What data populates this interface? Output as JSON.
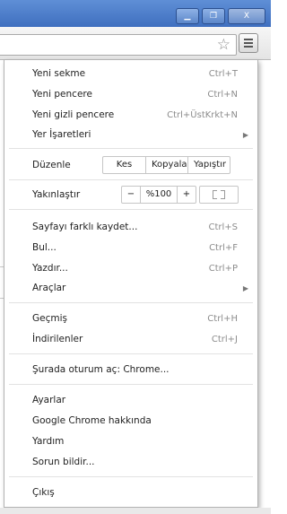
{
  "window": {
    "minimize": "▁",
    "maximize": "❐",
    "close": "X"
  },
  "toolbar": {
    "bookmark_icon": "star-icon",
    "menu_icon": "hamburger-icon"
  },
  "menu": {
    "new_tab": {
      "label": "Yeni sekme",
      "shortcut": "Ctrl+T"
    },
    "new_window": {
      "label": "Yeni pencere",
      "shortcut": "Ctrl+N"
    },
    "new_incognito": {
      "label": "Yeni gizli pencere",
      "shortcut": "Ctrl+ÜstKrkt+N"
    },
    "bookmarks": {
      "label": "Yer İşaretleri",
      "arrow": "▶"
    },
    "edit": {
      "label": "Düzenle",
      "cut": "Kes",
      "copy": "Kopyala",
      "paste": "Yapıştır"
    },
    "zoom": {
      "label": "Yakınlaştır",
      "minus": "−",
      "value": "%100",
      "plus": "+"
    },
    "save_page": {
      "label": "Sayfayı farklı kaydet...",
      "shortcut": "Ctrl+S"
    },
    "find": {
      "label": "Bul...",
      "shortcut": "Ctrl+F"
    },
    "print": {
      "label": "Yazdır...",
      "shortcut": "Ctrl+P"
    },
    "tools": {
      "label": "Araçlar",
      "arrow": "▶"
    },
    "history": {
      "label": "Geçmiş",
      "shortcut": "Ctrl+H"
    },
    "downloads": {
      "label": "İndirilenler",
      "shortcut": "Ctrl+J"
    },
    "signin": {
      "label": "Şurada oturum aç: Chrome..."
    },
    "settings": {
      "label": "Ayarlar"
    },
    "about": {
      "label": "Google Chrome hakkında"
    },
    "help": {
      "label": "Yardım"
    },
    "report": {
      "label": "Sorun bildir..."
    },
    "exit": {
      "label": "Çıkış"
    }
  }
}
